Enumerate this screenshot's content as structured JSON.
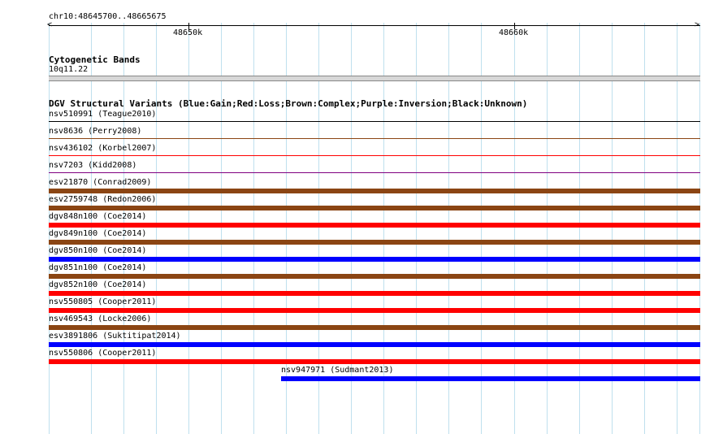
{
  "ruler": {
    "coordinates": "chr10:48645700..48665675",
    "ticks": [
      "48650k",
      "48660k"
    ]
  },
  "cytoband": {
    "title": "Cytogenetic Bands",
    "band": "10q11.22",
    "band_color": "#d7d7d7"
  },
  "dgv": {
    "title": "DGV Structural Variants (Blue:Gain;Red:Loss;Brown:Complex;Purple:Inversion;Black:Unknown)",
    "colors": {
      "gain": "#0000ff",
      "loss": "#ff0000",
      "complex": "#8b4513",
      "inversion": "#800080",
      "unknown": "#000000",
      "gridline": "#bfe0ee"
    },
    "features": [
      {
        "label": "nsv510991 (Teague2010)",
        "type": "unknown",
        "thickness": "thin"
      },
      {
        "label": "nsv8636 (Perry2008)",
        "type": "complex",
        "thickness": "thin"
      },
      {
        "label": "nsv436102 (Korbel2007)",
        "type": "loss",
        "thickness": "thin"
      },
      {
        "label": "nsv7203 (Kidd2008)",
        "type": "inversion",
        "thickness": "thin"
      },
      {
        "label": "esv21870 (Conrad2009)",
        "type": "complex",
        "thickness": "thick"
      },
      {
        "label": "esv2759748 (Redon2006)",
        "type": "complex",
        "thickness": "thick"
      },
      {
        "label": "dgv848n100 (Coe2014)",
        "type": "loss",
        "thickness": "thick"
      },
      {
        "label": "dgv849n100 (Coe2014)",
        "type": "complex",
        "thickness": "thick"
      },
      {
        "label": "dgv850n100 (Coe2014)",
        "type": "gain",
        "thickness": "thick"
      },
      {
        "label": "dgv851n100 (Coe2014)",
        "type": "complex",
        "thickness": "thick"
      },
      {
        "label": "dgv852n100 (Coe2014)",
        "type": "loss",
        "thickness": "thick"
      },
      {
        "label": "nsv550805 (Cooper2011)",
        "type": "loss",
        "thickness": "thick"
      },
      {
        "label": "nsv469543 (Locke2006)",
        "type": "complex",
        "thickness": "thick"
      },
      {
        "label": "esv3891806 (Suktitipat2014)",
        "type": "gain",
        "thickness": "thick"
      },
      {
        "label": "nsv550806 (Cooper2011)",
        "type": "loss",
        "thickness": "thick"
      },
      {
        "label": "nsv947971 (Sudmant2013)",
        "type": "gain",
        "thickness": "thick",
        "partial": true
      }
    ]
  }
}
